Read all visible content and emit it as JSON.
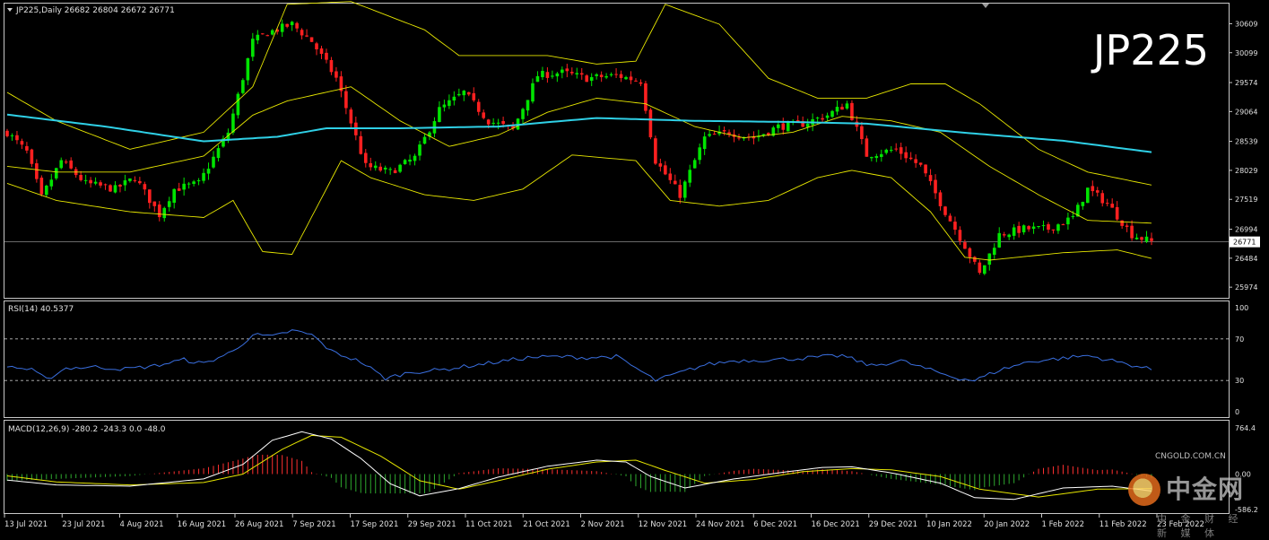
{
  "header": {
    "symbol_line": "JP225,Daily  26682 26804 26672 26771",
    "watermark_title": "JP225"
  },
  "watermark": {
    "brand": "中金网",
    "url": "CNGOLD.COM.CN",
    "tagline": "中 金 财 经 新 媒 体"
  },
  "colors": {
    "background": "#000000",
    "bull": "#00e400",
    "bear": "#ff2020",
    "bands": "#e6e600",
    "ma": "#2fd0e6",
    "rsi": "#3a6fe0",
    "macd_signal": "#e6e600",
    "macd_line": "#ffffff"
  },
  "chart_data": [
    {
      "name": "price",
      "type": "candlestick",
      "y_ticks": [
        30609,
        30099,
        29574,
        29064,
        28539,
        28029,
        27519,
        26994,
        26484,
        25974
      ],
      "last_price_label": "26771",
      "ylim": [
        25850,
        30900
      ],
      "x_tick_labels": [
        "13 Jul 2021",
        "23 Jul 2021",
        "4 Aug 2021",
        "16 Aug 2021",
        "26 Aug 2021",
        "7 Sep 2021",
        "17 Sep 2021",
        "29 Sep 2021",
        "11 Oct 2021",
        "21 Oct 2021",
        "2 Nov 2021",
        "12 Nov 2021",
        "24 Nov 2021",
        "6 Dec 2021",
        "16 Dec 2021",
        "29 Dec 2021",
        "10 Jan 2022",
        "20 Jan 2022",
        "1 Feb 2022",
        "11 Feb 2022",
        "23 Feb 2022"
      ],
      "close_anchors": [
        [
          0,
          28700
        ],
        [
          4,
          28350
        ],
        [
          7,
          27550
        ],
        [
          11,
          28200
        ],
        [
          16,
          27800
        ],
        [
          22,
          27700
        ],
        [
          26,
          27900
        ],
        [
          31,
          27250
        ],
        [
          34,
          27700
        ],
        [
          39,
          27800
        ],
        [
          45,
          28700
        ],
        [
          50,
          30300
        ],
        [
          53,
          30450
        ],
        [
          58,
          30600
        ],
        [
          62,
          30300
        ],
        [
          67,
          29650
        ],
        [
          73,
          28100
        ],
        [
          78,
          28000
        ],
        [
          83,
          28250
        ],
        [
          88,
          29100
        ],
        [
          93,
          29400
        ],
        [
          98,
          28900
        ],
        [
          103,
          28750
        ],
        [
          108,
          29700
        ],
        [
          113,
          29750
        ],
        [
          118,
          29650
        ],
        [
          124,
          29700
        ],
        [
          129,
          29600
        ],
        [
          132,
          28200
        ],
        [
          137,
          27600
        ],
        [
          142,
          28600
        ],
        [
          147,
          28700
        ],
        [
          152,
          28600
        ],
        [
          157,
          28800
        ],
        [
          162,
          28850
        ],
        [
          167,
          29000
        ],
        [
          171,
          29200
        ],
        [
          175,
          28300
        ],
        [
          181,
          28400
        ],
        [
          186,
          28100
        ],
        [
          191,
          27300
        ],
        [
          195,
          26700
        ],
        [
          198,
          26200
        ],
        [
          202,
          26900
        ],
        [
          207,
          27000
        ],
        [
          212,
          27000
        ],
        [
          217,
          27200
        ],
        [
          220,
          27700
        ],
        [
          224,
          27450
        ],
        [
          229,
          26900
        ],
        [
          233,
          26771
        ]
      ],
      "ma200": [
        [
          0,
          29010
        ],
        [
          20,
          28800
        ],
        [
          40,
          28540
        ],
        [
          55,
          28620
        ],
        [
          65,
          28770
        ],
        [
          80,
          28770
        ],
        [
          100,
          28800
        ],
        [
          120,
          28950
        ],
        [
          140,
          28900
        ],
        [
          160,
          28880
        ],
        [
          175,
          28850
        ],
        [
          195,
          28690
        ],
        [
          215,
          28550
        ],
        [
          233,
          28350
        ]
      ],
      "bb_upper": [
        [
          0,
          29400
        ],
        [
          10,
          28900
        ],
        [
          25,
          28400
        ],
        [
          40,
          28700
        ],
        [
          50,
          29500
        ],
        [
          57,
          30950
        ],
        [
          70,
          31000
        ],
        [
          85,
          30500
        ],
        [
          92,
          30050
        ],
        [
          100,
          30050
        ],
        [
          110,
          30050
        ],
        [
          120,
          29900
        ],
        [
          128,
          29950
        ],
        [
          134,
          30950
        ],
        [
          145,
          30600
        ],
        [
          155,
          29650
        ],
        [
          165,
          29300
        ],
        [
          175,
          29300
        ],
        [
          184,
          29550
        ],
        [
          191,
          29550
        ],
        [
          198,
          29200
        ],
        [
          210,
          28400
        ],
        [
          220,
          28000
        ],
        [
          233,
          27770
        ]
      ],
      "bb_middle": [
        [
          0,
          28100
        ],
        [
          10,
          28000
        ],
        [
          25,
          28000
        ],
        [
          40,
          28280
        ],
        [
          50,
          29000
        ],
        [
          57,
          29250
        ],
        [
          70,
          29500
        ],
        [
          80,
          28900
        ],
        [
          90,
          28450
        ],
        [
          100,
          28650
        ],
        [
          110,
          29050
        ],
        [
          120,
          29300
        ],
        [
          130,
          29200
        ],
        [
          140,
          28800
        ],
        [
          150,
          28600
        ],
        [
          160,
          28700
        ],
        [
          170,
          28980
        ],
        [
          180,
          28900
        ],
        [
          190,
          28700
        ],
        [
          200,
          28100
        ],
        [
          210,
          27600
        ],
        [
          220,
          27150
        ],
        [
          233,
          27100
        ]
      ],
      "bb_lower": [
        [
          0,
          27800
        ],
        [
          10,
          27500
        ],
        [
          25,
          27300
        ],
        [
          40,
          27200
        ],
        [
          46,
          27500
        ],
        [
          52,
          26600
        ],
        [
          58,
          26550
        ],
        [
          68,
          28200
        ],
        [
          74,
          27900
        ],
        [
          85,
          27600
        ],
        [
          95,
          27500
        ],
        [
          105,
          27700
        ],
        [
          115,
          28300
        ],
        [
          128,
          28200
        ],
        [
          135,
          27500
        ],
        [
          145,
          27400
        ],
        [
          155,
          27500
        ],
        [
          165,
          27900
        ],
        [
          172,
          28030
        ],
        [
          180,
          27900
        ],
        [
          188,
          27300
        ],
        [
          195,
          26500
        ],
        [
          200,
          26450
        ],
        [
          215,
          26580
        ],
        [
          226,
          26630
        ],
        [
          233,
          26480
        ]
      ]
    },
    {
      "name": "rsi",
      "type": "line",
      "label": "RSI(14) 40.5377",
      "y_ticks": [
        100,
        70,
        30,
        0
      ],
      "levels": [
        70,
        30
      ],
      "ylim": [
        0,
        100
      ],
      "values": [
        [
          0,
          44
        ],
        [
          5,
          40
        ],
        [
          8,
          31
        ],
        [
          12,
          42
        ],
        [
          18,
          43
        ],
        [
          24,
          41
        ],
        [
          30,
          44
        ],
        [
          36,
          50
        ],
        [
          40,
          46
        ],
        [
          46,
          58
        ],
        [
          50,
          74
        ],
        [
          54,
          72
        ],
        [
          58,
          78
        ],
        [
          62,
          74
        ],
        [
          66,
          58
        ],
        [
          72,
          48
        ],
        [
          77,
          32
        ],
        [
          82,
          38
        ],
        [
          88,
          40
        ],
        [
          94,
          44
        ],
        [
          100,
          48
        ],
        [
          106,
          52
        ],
        [
          112,
          53
        ],
        [
          118,
          52
        ],
        [
          124,
          53
        ],
        [
          128,
          42
        ],
        [
          132,
          30
        ],
        [
          136,
          36
        ],
        [
          142,
          45
        ],
        [
          148,
          49
        ],
        [
          156,
          50
        ],
        [
          164,
          52
        ],
        [
          170,
          54
        ],
        [
          176,
          44
        ],
        [
          182,
          49
        ],
        [
          188,
          40
        ],
        [
          193,
          33
        ],
        [
          197,
          30
        ],
        [
          202,
          40
        ],
        [
          208,
          48
        ],
        [
          214,
          51
        ],
        [
          220,
          54
        ],
        [
          226,
          48
        ],
        [
          233,
          40.54
        ]
      ]
    },
    {
      "name": "macd",
      "type": "histogram+line",
      "label": "MACD(12,26,9) -280.2 -243.3 0.0 -48.0",
      "y_ticks": [
        764.4,
        0.0,
        -586.2
      ],
      "ylim": [
        -586.2,
        764.4
      ],
      "macd": [
        [
          0,
          -100
        ],
        [
          10,
          -180
        ],
        [
          25,
          -200
        ],
        [
          40,
          -80
        ],
        [
          48,
          160
        ],
        [
          54,
          560
        ],
        [
          60,
          700
        ],
        [
          66,
          580
        ],
        [
          72,
          260
        ],
        [
          78,
          -160
        ],
        [
          84,
          -360
        ],
        [
          92,
          -240
        ],
        [
          100,
          -50
        ],
        [
          110,
          130
        ],
        [
          120,
          230
        ],
        [
          126,
          200
        ],
        [
          131,
          -40
        ],
        [
          138,
          -230
        ],
        [
          148,
          -80
        ],
        [
          158,
          30
        ],
        [
          166,
          110
        ],
        [
          172,
          120
        ],
        [
          180,
          20
        ],
        [
          190,
          -150
        ],
        [
          197,
          -390
        ],
        [
          205,
          -420
        ],
        [
          215,
          -230
        ],
        [
          225,
          -200
        ],
        [
          233,
          -280
        ]
      ],
      "signal": [
        [
          0,
          -30
        ],
        [
          10,
          -130
        ],
        [
          25,
          -180
        ],
        [
          40,
          -140
        ],
        [
          48,
          0
        ],
        [
          56,
          410
        ],
        [
          62,
          640
        ],
        [
          68,
          610
        ],
        [
          76,
          300
        ],
        [
          84,
          -110
        ],
        [
          92,
          -250
        ],
        [
          100,
          -110
        ],
        [
          110,
          80
        ],
        [
          120,
          200
        ],
        [
          128,
          230
        ],
        [
          134,
          60
        ],
        [
          142,
          -150
        ],
        [
          152,
          -90
        ],
        [
          162,
          40
        ],
        [
          172,
          90
        ],
        [
          180,
          70
        ],
        [
          190,
          -40
        ],
        [
          198,
          -250
        ],
        [
          210,
          -380
        ],
        [
          222,
          -250
        ],
        [
          233,
          -240
        ]
      ],
      "histogram_amplitude": 320
    }
  ]
}
